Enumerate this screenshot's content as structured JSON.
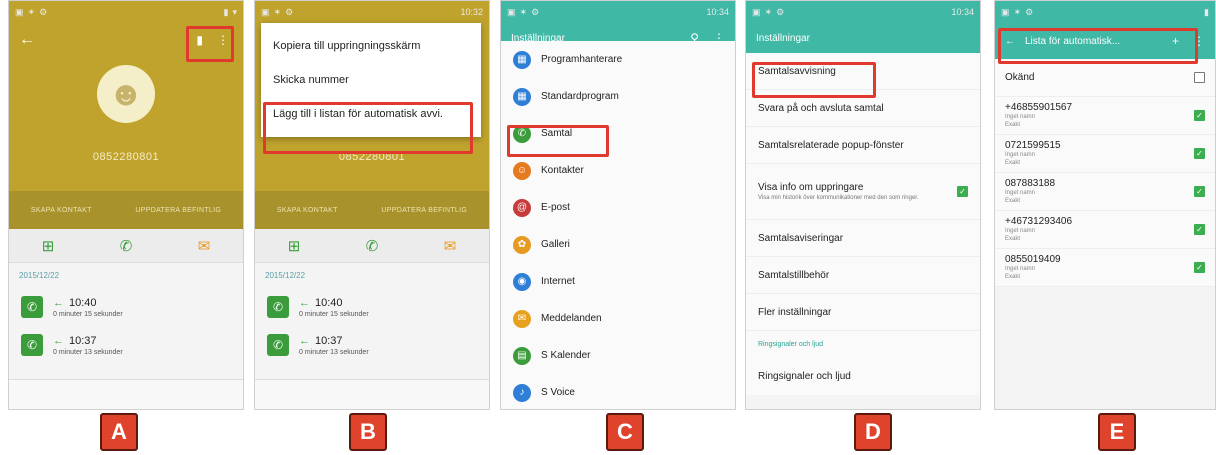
{
  "panels": {
    "a": {
      "label": "A"
    },
    "b": {
      "label": "B"
    },
    "c": {
      "label": "C"
    },
    "d": {
      "label": "D"
    },
    "e": {
      "label": "E"
    }
  },
  "contact": {
    "number": "0852280801",
    "create_contact": "SKAPA KONTAKT",
    "update_existing": "UPPDATERA BEFINTLIG",
    "log_date": "2015/12/22",
    "logs": [
      {
        "time": "10:40",
        "duration": "0 minuter 15 sekunder"
      },
      {
        "time": "10:37",
        "duration": "0 minuter 13 sekunder"
      }
    ]
  },
  "menu": {
    "items": [
      "Kopiera till uppringningsskärm",
      "Skicka nummer",
      "Lägg till i listan för automatisk avvi."
    ]
  },
  "settings_c": {
    "title": "Inställningar",
    "items": [
      {
        "label": "Programhanterare",
        "color": "#2f7fd6"
      },
      {
        "label": "Standardprogram",
        "color": "#2f7fd6"
      },
      {
        "label": "Samtal",
        "color": "#3a9c3a"
      },
      {
        "label": "Kontakter",
        "color": "#e67a1f"
      },
      {
        "label": "E-post",
        "color": "#c73b3b"
      },
      {
        "label": "Galleri",
        "color": "#e69a1f"
      },
      {
        "label": "Internet",
        "color": "#2f7fd6"
      },
      {
        "label": "Meddelanden",
        "color": "#e6a21f"
      },
      {
        "label": "S Kalender",
        "color": "#3a9c3a"
      },
      {
        "label": "S Voice",
        "color": "#2f7fd6"
      }
    ]
  },
  "settings_d": {
    "title": "Inställningar",
    "items": [
      "Samtalsavvisning",
      "Svara på och avsluta samtal",
      "Samtalsrelaterade popup-fönster"
    ],
    "caller_info": {
      "label": "Visa info om uppringare",
      "sub": "Visa min historik över kommunikationer med den som ringer."
    },
    "items2": [
      "Samtalsaviseringar",
      "Samtalstillbehör",
      "Fler inställningar"
    ],
    "section": "Ringsignaler och ljud",
    "last": "Ringsignaler och ljud"
  },
  "settings_e": {
    "title": "Lista för automatisk...",
    "unknown": "Okänd",
    "entries": [
      {
        "number": "+46855901567",
        "line1": "Inget namn",
        "line2": "Exakt"
      },
      {
        "number": "0721599515",
        "line1": "Inget namn",
        "line2": "Exakt"
      },
      {
        "number": "087883188",
        "line1": "Inget namn",
        "line2": "Exakt"
      },
      {
        "number": "+46731293406",
        "line1": "Inget namn",
        "line2": "Exakt"
      },
      {
        "number": "0855019409",
        "line1": "Inget namn",
        "line2": "Exakt"
      }
    ]
  },
  "status": {
    "time_b": "10:32",
    "time_c": "10:34",
    "time_d": "10:34"
  },
  "colors": {
    "highlight": "#e03a2f",
    "gold": "#bfa32d",
    "teal": "#3fb8a6"
  }
}
